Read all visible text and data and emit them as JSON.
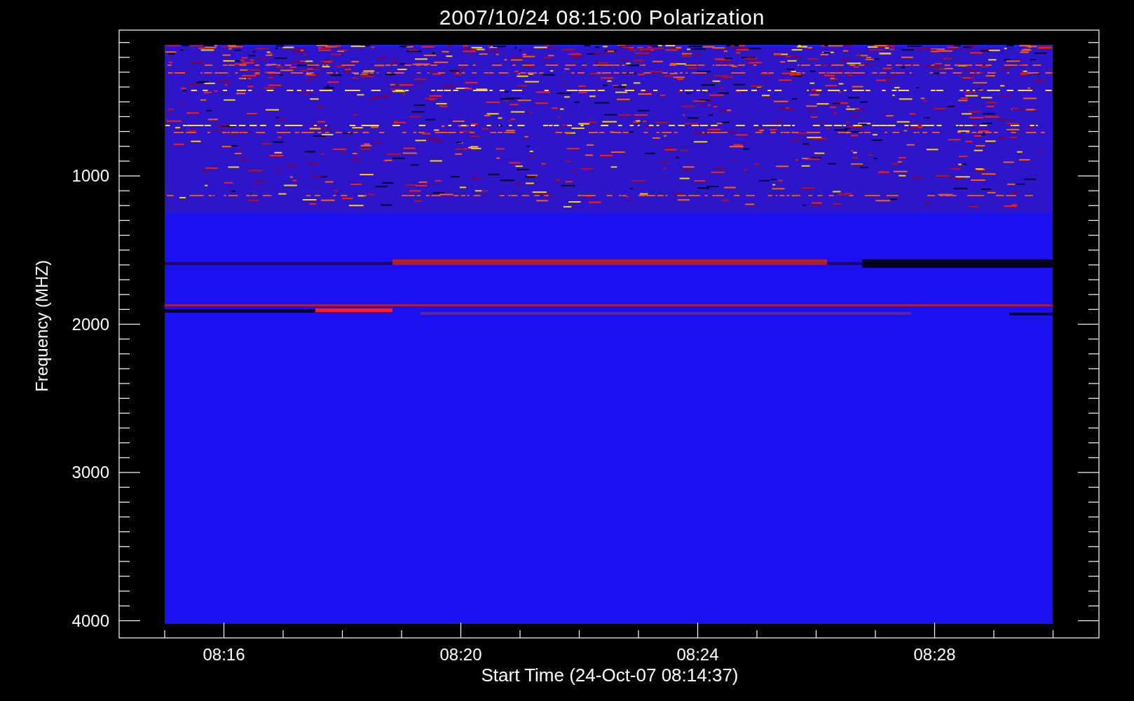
{
  "title": "2007/10/24 08:15:00 Polarization",
  "y_axis": {
    "label": "Frequency (MHZ)",
    "tick_labels": [
      "1000",
      "2000",
      "3000",
      "4000"
    ]
  },
  "x_axis": {
    "label": "Start Time (24-Oct-07 08:14:37)",
    "tick_labels": [
      "08:16",
      "08:20",
      "08:24",
      "08:28"
    ]
  }
}
